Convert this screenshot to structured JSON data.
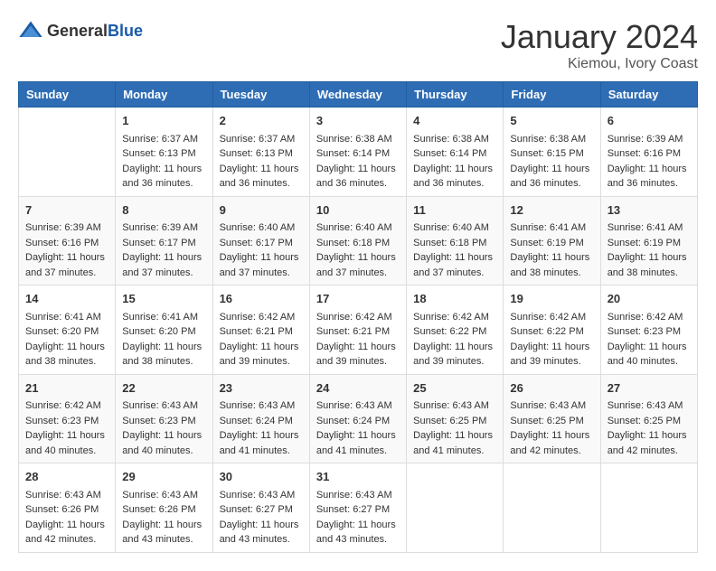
{
  "header": {
    "logo_general": "General",
    "logo_blue": "Blue",
    "month_title": "January 2024",
    "location": "Kiemou, Ivory Coast"
  },
  "days_of_week": [
    "Sunday",
    "Monday",
    "Tuesday",
    "Wednesday",
    "Thursday",
    "Friday",
    "Saturday"
  ],
  "weeks": [
    [
      {
        "day": "",
        "sunrise": "",
        "sunset": "",
        "daylight": ""
      },
      {
        "day": "1",
        "sunrise": "Sunrise: 6:37 AM",
        "sunset": "Sunset: 6:13 PM",
        "daylight": "Daylight: 11 hours and 36 minutes."
      },
      {
        "day": "2",
        "sunrise": "Sunrise: 6:37 AM",
        "sunset": "Sunset: 6:13 PM",
        "daylight": "Daylight: 11 hours and 36 minutes."
      },
      {
        "day": "3",
        "sunrise": "Sunrise: 6:38 AM",
        "sunset": "Sunset: 6:14 PM",
        "daylight": "Daylight: 11 hours and 36 minutes."
      },
      {
        "day": "4",
        "sunrise": "Sunrise: 6:38 AM",
        "sunset": "Sunset: 6:14 PM",
        "daylight": "Daylight: 11 hours and 36 minutes."
      },
      {
        "day": "5",
        "sunrise": "Sunrise: 6:38 AM",
        "sunset": "Sunset: 6:15 PM",
        "daylight": "Daylight: 11 hours and 36 minutes."
      },
      {
        "day": "6",
        "sunrise": "Sunrise: 6:39 AM",
        "sunset": "Sunset: 6:16 PM",
        "daylight": "Daylight: 11 hours and 36 minutes."
      }
    ],
    [
      {
        "day": "7",
        "sunrise": "Sunrise: 6:39 AM",
        "sunset": "Sunset: 6:16 PM",
        "daylight": "Daylight: 11 hours and 37 minutes."
      },
      {
        "day": "8",
        "sunrise": "Sunrise: 6:39 AM",
        "sunset": "Sunset: 6:17 PM",
        "daylight": "Daylight: 11 hours and 37 minutes."
      },
      {
        "day": "9",
        "sunrise": "Sunrise: 6:40 AM",
        "sunset": "Sunset: 6:17 PM",
        "daylight": "Daylight: 11 hours and 37 minutes."
      },
      {
        "day": "10",
        "sunrise": "Sunrise: 6:40 AM",
        "sunset": "Sunset: 6:18 PM",
        "daylight": "Daylight: 11 hours and 37 minutes."
      },
      {
        "day": "11",
        "sunrise": "Sunrise: 6:40 AM",
        "sunset": "Sunset: 6:18 PM",
        "daylight": "Daylight: 11 hours and 37 minutes."
      },
      {
        "day": "12",
        "sunrise": "Sunrise: 6:41 AM",
        "sunset": "Sunset: 6:19 PM",
        "daylight": "Daylight: 11 hours and 38 minutes."
      },
      {
        "day": "13",
        "sunrise": "Sunrise: 6:41 AM",
        "sunset": "Sunset: 6:19 PM",
        "daylight": "Daylight: 11 hours and 38 minutes."
      }
    ],
    [
      {
        "day": "14",
        "sunrise": "Sunrise: 6:41 AM",
        "sunset": "Sunset: 6:20 PM",
        "daylight": "Daylight: 11 hours and 38 minutes."
      },
      {
        "day": "15",
        "sunrise": "Sunrise: 6:41 AM",
        "sunset": "Sunset: 6:20 PM",
        "daylight": "Daylight: 11 hours and 38 minutes."
      },
      {
        "day": "16",
        "sunrise": "Sunrise: 6:42 AM",
        "sunset": "Sunset: 6:21 PM",
        "daylight": "Daylight: 11 hours and 39 minutes."
      },
      {
        "day": "17",
        "sunrise": "Sunrise: 6:42 AM",
        "sunset": "Sunset: 6:21 PM",
        "daylight": "Daylight: 11 hours and 39 minutes."
      },
      {
        "day": "18",
        "sunrise": "Sunrise: 6:42 AM",
        "sunset": "Sunset: 6:22 PM",
        "daylight": "Daylight: 11 hours and 39 minutes."
      },
      {
        "day": "19",
        "sunrise": "Sunrise: 6:42 AM",
        "sunset": "Sunset: 6:22 PM",
        "daylight": "Daylight: 11 hours and 39 minutes."
      },
      {
        "day": "20",
        "sunrise": "Sunrise: 6:42 AM",
        "sunset": "Sunset: 6:23 PM",
        "daylight": "Daylight: 11 hours and 40 minutes."
      }
    ],
    [
      {
        "day": "21",
        "sunrise": "Sunrise: 6:42 AM",
        "sunset": "Sunset: 6:23 PM",
        "daylight": "Daylight: 11 hours and 40 minutes."
      },
      {
        "day": "22",
        "sunrise": "Sunrise: 6:43 AM",
        "sunset": "Sunset: 6:23 PM",
        "daylight": "Daylight: 11 hours and 40 minutes."
      },
      {
        "day": "23",
        "sunrise": "Sunrise: 6:43 AM",
        "sunset": "Sunset: 6:24 PM",
        "daylight": "Daylight: 11 hours and 41 minutes."
      },
      {
        "day": "24",
        "sunrise": "Sunrise: 6:43 AM",
        "sunset": "Sunset: 6:24 PM",
        "daylight": "Daylight: 11 hours and 41 minutes."
      },
      {
        "day": "25",
        "sunrise": "Sunrise: 6:43 AM",
        "sunset": "Sunset: 6:25 PM",
        "daylight": "Daylight: 11 hours and 41 minutes."
      },
      {
        "day": "26",
        "sunrise": "Sunrise: 6:43 AM",
        "sunset": "Sunset: 6:25 PM",
        "daylight": "Daylight: 11 hours and 42 minutes."
      },
      {
        "day": "27",
        "sunrise": "Sunrise: 6:43 AM",
        "sunset": "Sunset: 6:25 PM",
        "daylight": "Daylight: 11 hours and 42 minutes."
      }
    ],
    [
      {
        "day": "28",
        "sunrise": "Sunrise: 6:43 AM",
        "sunset": "Sunset: 6:26 PM",
        "daylight": "Daylight: 11 hours and 42 minutes."
      },
      {
        "day": "29",
        "sunrise": "Sunrise: 6:43 AM",
        "sunset": "Sunset: 6:26 PM",
        "daylight": "Daylight: 11 hours and 43 minutes."
      },
      {
        "day": "30",
        "sunrise": "Sunrise: 6:43 AM",
        "sunset": "Sunset: 6:27 PM",
        "daylight": "Daylight: 11 hours and 43 minutes."
      },
      {
        "day": "31",
        "sunrise": "Sunrise: 6:43 AM",
        "sunset": "Sunset: 6:27 PM",
        "daylight": "Daylight: 11 hours and 43 minutes."
      },
      {
        "day": "",
        "sunrise": "",
        "sunset": "",
        "daylight": ""
      },
      {
        "day": "",
        "sunrise": "",
        "sunset": "",
        "daylight": ""
      },
      {
        "day": "",
        "sunrise": "",
        "sunset": "",
        "daylight": ""
      }
    ]
  ]
}
